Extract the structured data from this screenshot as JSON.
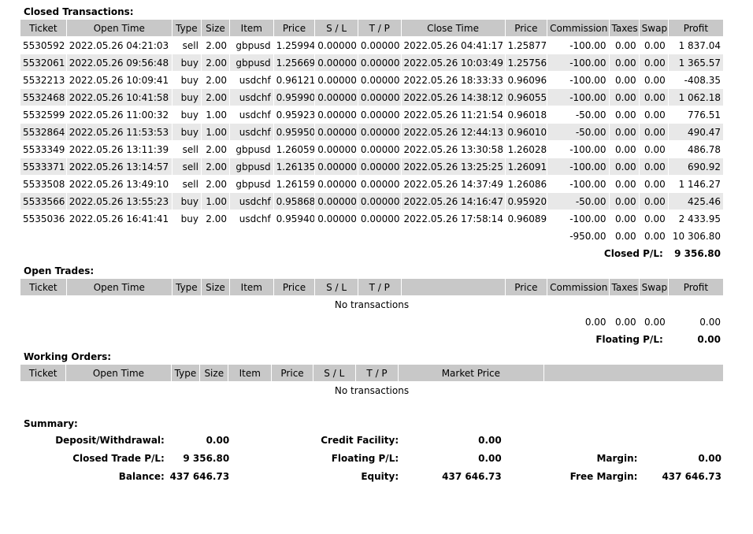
{
  "closed": {
    "title": "Closed Transactions:",
    "headers": [
      "Ticket",
      "Open Time",
      "Type",
      "Size",
      "Item",
      "Price",
      "S / L",
      "T / P",
      "Close Time",
      "Price",
      "Commission",
      "Taxes",
      "Swap",
      "Profit"
    ],
    "rows": [
      [
        "5530592",
        "2022.05.26 04:21:03",
        "sell",
        "2.00",
        "gbpusd",
        "1.25994",
        "0.00000",
        "0.00000",
        "2022.05.26 04:41:17",
        "1.25877",
        "-100.00",
        "0.00",
        "0.00",
        "1 837.04"
      ],
      [
        "5532061",
        "2022.05.26 09:56:48",
        "buy",
        "2.00",
        "gbpusd",
        "1.25669",
        "0.00000",
        "0.00000",
        "2022.05.26 10:03:49",
        "1.25756",
        "-100.00",
        "0.00",
        "0.00",
        "1 365.57"
      ],
      [
        "5532213",
        "2022.05.26 10:09:41",
        "buy",
        "2.00",
        "usdchf",
        "0.96121",
        "0.00000",
        "0.00000",
        "2022.05.26 18:33:33",
        "0.96096",
        "-100.00",
        "0.00",
        "0.00",
        "-408.35"
      ],
      [
        "5532468",
        "2022.05.26 10:41:58",
        "buy",
        "2.00",
        "usdchf",
        "0.95990",
        "0.00000",
        "0.00000",
        "2022.05.26 14:38:12",
        "0.96055",
        "-100.00",
        "0.00",
        "0.00",
        "1 062.18"
      ],
      [
        "5532599",
        "2022.05.26 11:00:32",
        "buy",
        "1.00",
        "usdchf",
        "0.95923",
        "0.00000",
        "0.00000",
        "2022.05.26 11:21:54",
        "0.96018",
        "-50.00",
        "0.00",
        "0.00",
        "776.51"
      ],
      [
        "5532864",
        "2022.05.26 11:53:53",
        "buy",
        "1.00",
        "usdchf",
        "0.95950",
        "0.00000",
        "0.00000",
        "2022.05.26 12:44:13",
        "0.96010",
        "-50.00",
        "0.00",
        "0.00",
        "490.47"
      ],
      [
        "5533349",
        "2022.05.26 13:11:39",
        "sell",
        "2.00",
        "gbpusd",
        "1.26059",
        "0.00000",
        "0.00000",
        "2022.05.26 13:30:58",
        "1.26028",
        "-100.00",
        "0.00",
        "0.00",
        "486.78"
      ],
      [
        "5533371",
        "2022.05.26 13:14:57",
        "sell",
        "2.00",
        "gbpusd",
        "1.26135",
        "0.00000",
        "0.00000",
        "2022.05.26 13:25:25",
        "1.26091",
        "-100.00",
        "0.00",
        "0.00",
        "690.92"
      ],
      [
        "5533508",
        "2022.05.26 13:49:10",
        "sell",
        "2.00",
        "gbpusd",
        "1.26159",
        "0.00000",
        "0.00000",
        "2022.05.26 14:37:49",
        "1.26086",
        "-100.00",
        "0.00",
        "0.00",
        "1 146.27"
      ],
      [
        "5533566",
        "2022.05.26 13:55:23",
        "buy",
        "1.00",
        "usdchf",
        "0.95868",
        "0.00000",
        "0.00000",
        "2022.05.26 14:16:47",
        "0.95920",
        "-50.00",
        "0.00",
        "0.00",
        "425.46"
      ],
      [
        "5535036",
        "2022.05.26 16:41:41",
        "buy",
        "2.00",
        "usdchf",
        "0.95940",
        "0.00000",
        "0.00000",
        "2022.05.26 17:58:14",
        "0.96089",
        "-100.00",
        "0.00",
        "0.00",
        "2 433.95"
      ]
    ],
    "totals": {
      "commission": "-950.00",
      "taxes": "0.00",
      "swap": "0.00",
      "profit": "10 306.80"
    },
    "pl_label": "Closed P/L:",
    "pl_value": "9 356.80"
  },
  "open": {
    "title": "Open Trades:",
    "headers": [
      "Ticket",
      "Open Time",
      "Type",
      "Size",
      "Item",
      "Price",
      "S / L",
      "T / P",
      "",
      "Price",
      "Commission",
      "Taxes",
      "Swap",
      "Profit"
    ],
    "empty": "No transactions",
    "totals": {
      "commission": "0.00",
      "taxes": "0.00",
      "swap": "0.00",
      "profit": "0.00"
    },
    "pl_label": "Floating P/L:",
    "pl_value": "0.00"
  },
  "working": {
    "title": "Working Orders:",
    "headers": [
      "Ticket",
      "Open Time",
      "Type",
      "Size",
      "Item",
      "Price",
      "S / L",
      "T / P",
      "Market Price",
      ""
    ],
    "empty": "No transactions"
  },
  "summary": {
    "title": "Summary:",
    "deposit_label": "Deposit/Withdrawal:",
    "deposit_value": "0.00",
    "credit_label": "Credit Facility:",
    "credit_value": "0.00",
    "closed_pl_label": "Closed Trade P/L:",
    "closed_pl_value": "9 356.80",
    "floating_label": "Floating P/L:",
    "floating_value": "0.00",
    "margin_label": "Margin:",
    "margin_value": "0.00",
    "balance_label": "Balance:",
    "balance_value": "437 646.73",
    "equity_label": "Equity:",
    "equity_value": "437 646.73",
    "free_margin_label": "Free Margin:",
    "free_margin_value": "437 646.73"
  }
}
